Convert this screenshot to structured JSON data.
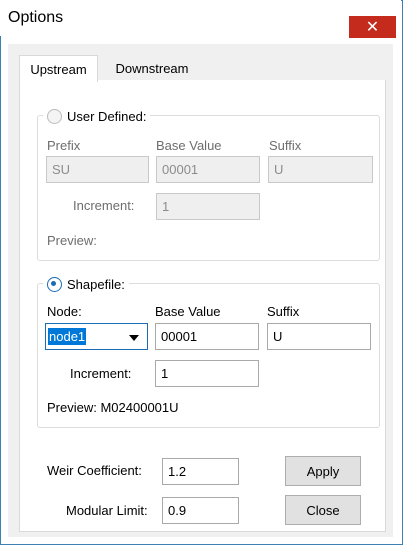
{
  "window": {
    "title": "Options",
    "close_glyph": "✕"
  },
  "tabs": [
    {
      "label": "Upstream",
      "active": true
    },
    {
      "label": "Downstream",
      "active": false
    }
  ],
  "user_defined": {
    "label": "User Defined:",
    "selected": false,
    "prefix_label": "Prefix",
    "prefix_value": "SU",
    "base_label": "Base Value",
    "base_value": "00001",
    "suffix_label": "Suffix",
    "suffix_value": "U",
    "increment_label": "Increment:",
    "increment_value": "1",
    "preview_label": "Preview:"
  },
  "shapefile": {
    "label": "Shapefile:",
    "selected": true,
    "node_label": "Node:",
    "node_value": "node1",
    "base_label": "Base Value",
    "base_value": "00001",
    "suffix_label": "Suffix",
    "suffix_value": "U",
    "increment_label": "Increment:",
    "increment_value": "1",
    "preview_text": "Preview: M02400001U"
  },
  "bottom": {
    "weir_label": "Weir Coefficient:",
    "weir_value": "1.2",
    "modular_label": "Modular Limit:",
    "modular_value": "0.9",
    "apply_label": "Apply",
    "close_label": "Close"
  },
  "colors": {
    "accent": "#0078d7",
    "close_red": "#c42b1c",
    "window_border": "#3c7fb1"
  }
}
